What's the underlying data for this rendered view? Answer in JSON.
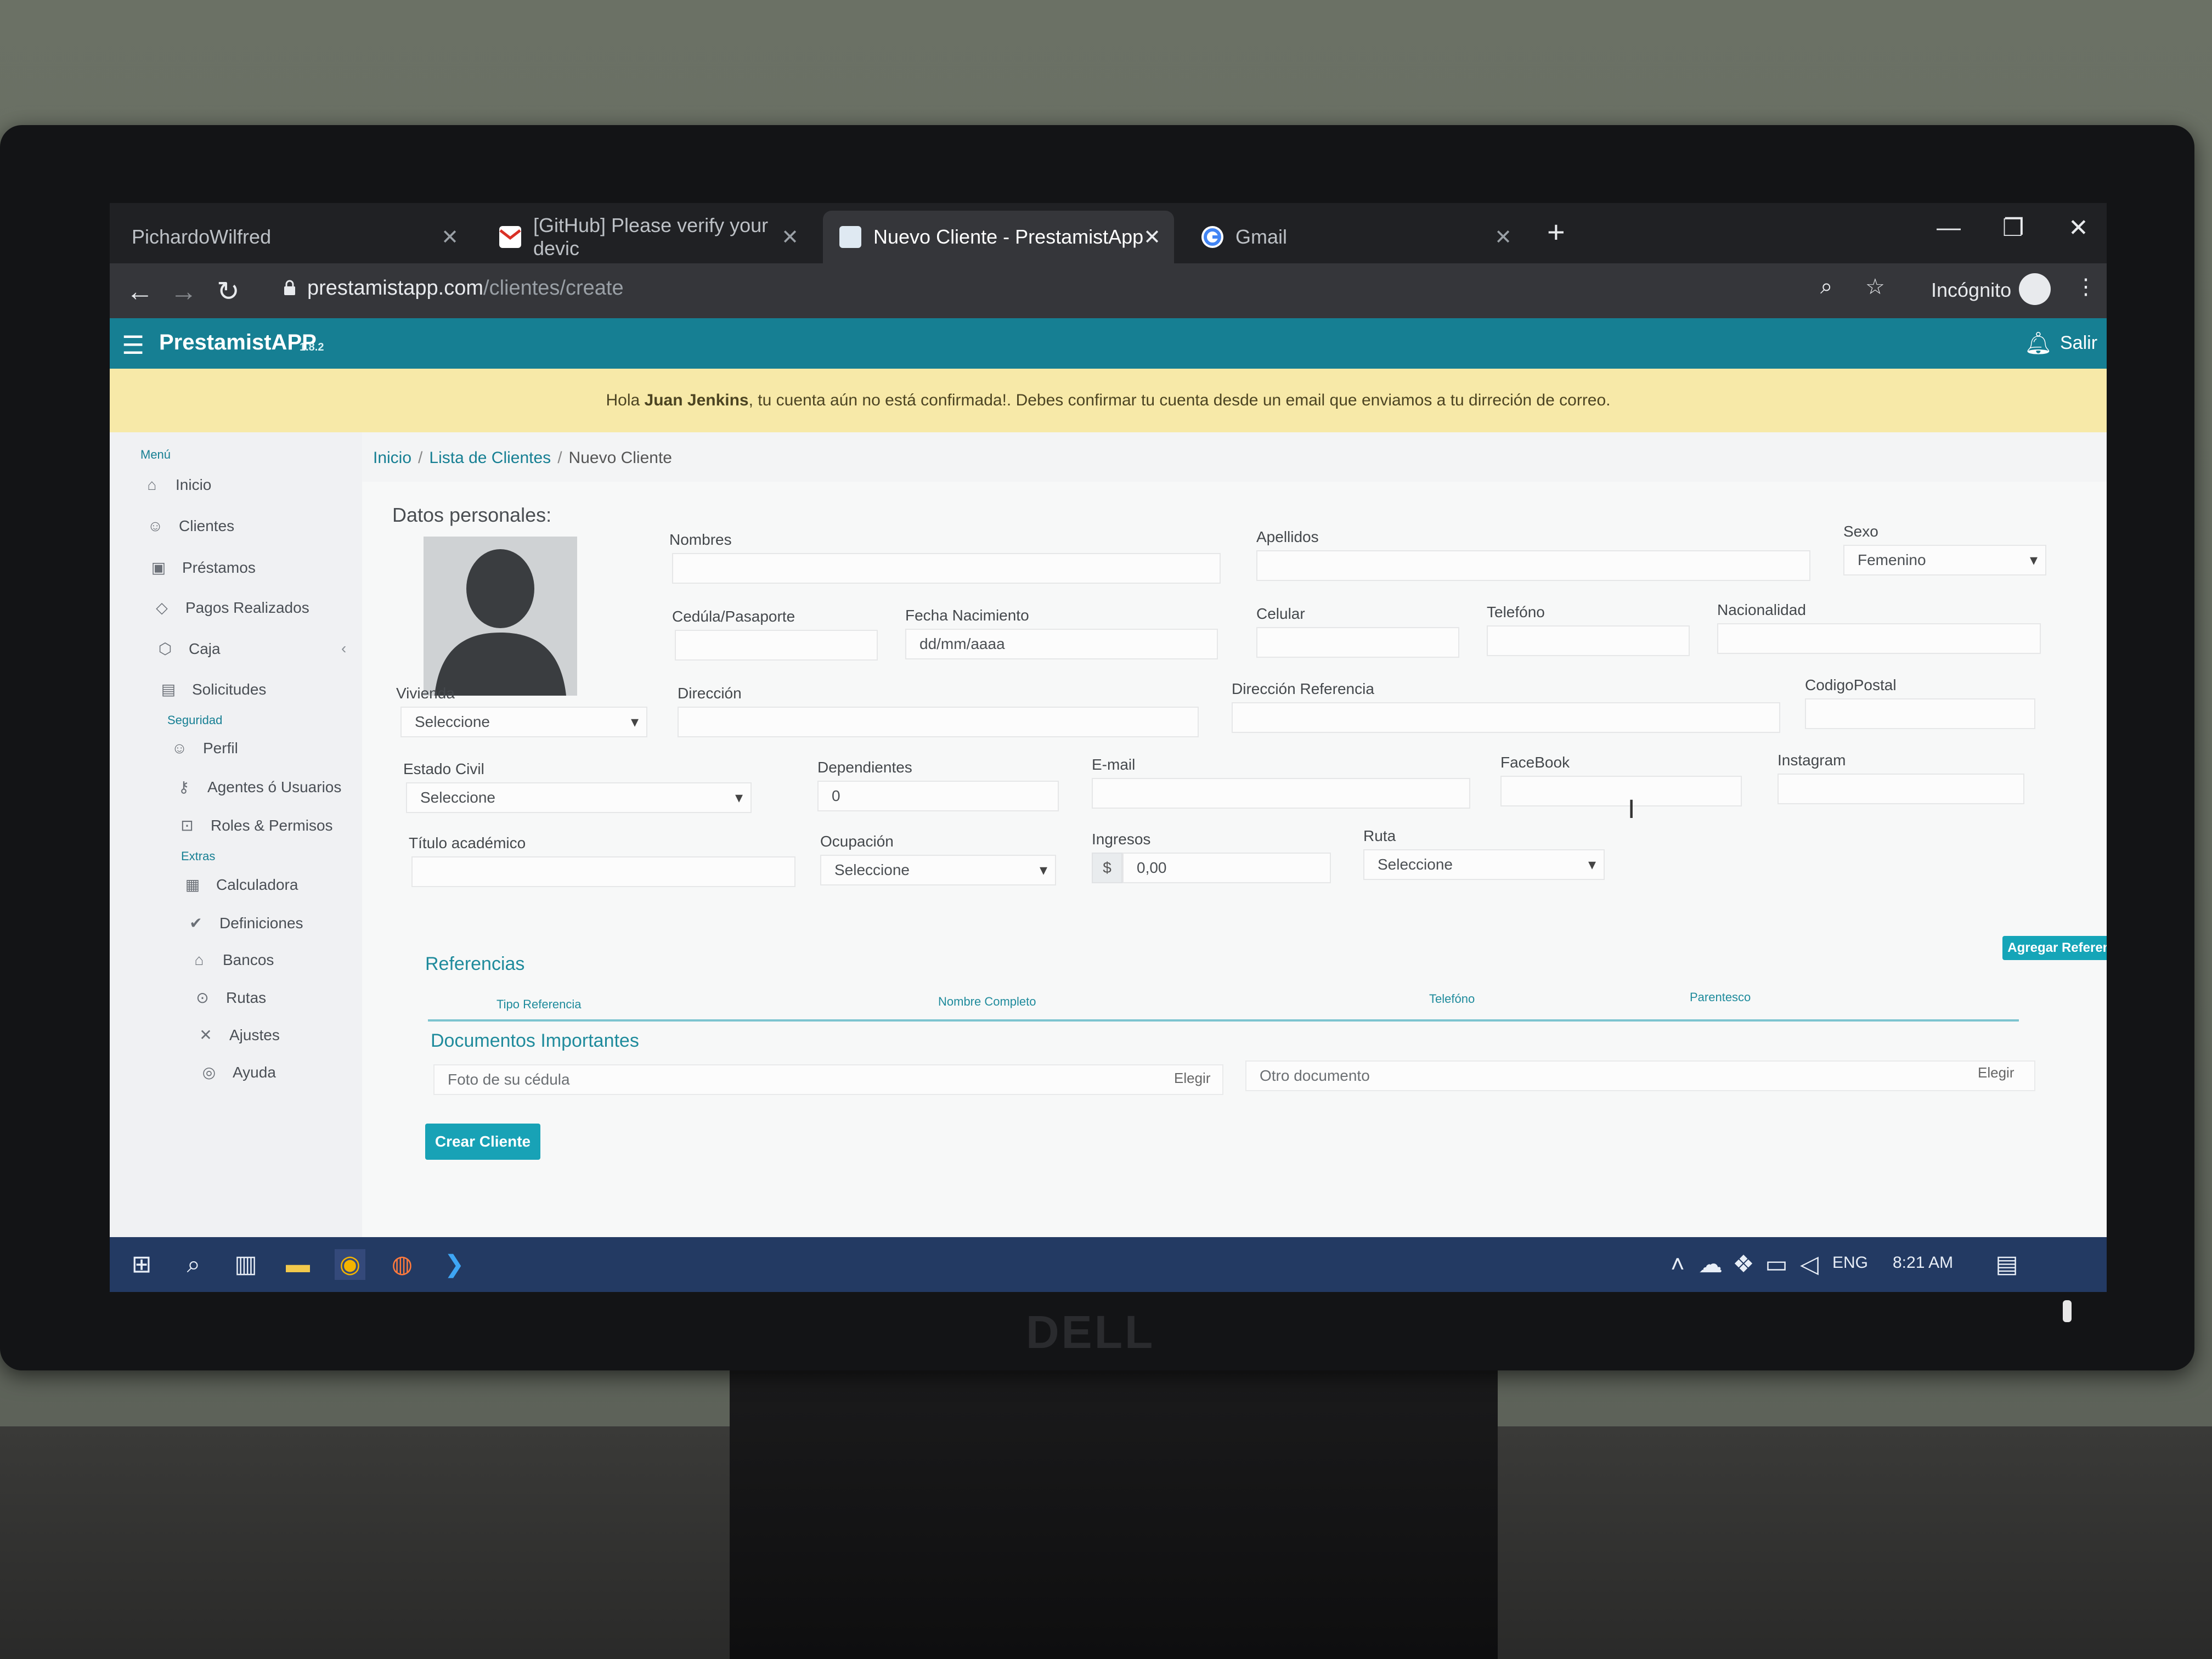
{
  "browser": {
    "tabs": [
      {
        "label": "PichardoWilfred",
        "icon": "blank-page-icon"
      },
      {
        "label": "[GitHub] Please verify your devic",
        "icon": "gmail-icon"
      },
      {
        "label": "Nuevo Cliente - PrestamistApp",
        "icon": "prestamistapp-icon"
      },
      {
        "label": "Gmail",
        "icon": "google-icon"
      }
    ],
    "active_tab": 2,
    "url_host": "prestamistapp.com",
    "url_path": "/clientes/create",
    "incognito_label": "Incógnito"
  },
  "app": {
    "title": "PrestamistAPP",
    "version": "1.8.2",
    "logout_label": "Salir",
    "alert_prefix": "Hola ",
    "alert_name": "Juan Jenkins",
    "alert_rest": ", tu cuenta aún no está confirmada!. Debes confirmar tu cuenta desde un email que enviamos a tu dirreción de correo."
  },
  "sidebar": {
    "menu_heading": "Menú",
    "security_heading": "Seguridad",
    "extras_heading": "Extras",
    "items": [
      {
        "label": "Inicio",
        "icon": "home-icon"
      },
      {
        "label": "Clientes",
        "icon": "user-icon"
      },
      {
        "label": "Préstamos",
        "icon": "wallet-icon"
      },
      {
        "label": "Pagos Realizados",
        "icon": "tag-icon"
      },
      {
        "label": "Caja",
        "icon": "box-icon"
      },
      {
        "label": "Solicitudes",
        "icon": "inbox-icon"
      },
      {
        "label": "Perfil",
        "icon": "user-icon"
      },
      {
        "label": "Agentes ó Usuarios",
        "icon": "key-icon"
      },
      {
        "label": "Roles & Permisos",
        "icon": "lock-icon"
      },
      {
        "label": "Calculadora",
        "icon": "calculator-icon"
      },
      {
        "label": "Definiciones",
        "icon": "check-icon"
      },
      {
        "label": "Bancos",
        "icon": "bank-icon"
      },
      {
        "label": "Rutas",
        "icon": "map-pin-icon"
      },
      {
        "label": "Ajustes",
        "icon": "tools-icon"
      },
      {
        "label": "Ayuda",
        "icon": "lifebuoy-icon"
      }
    ]
  },
  "breadcrumb": {
    "home": "Inicio",
    "list": "Lista de Clientes",
    "current": "Nuevo Cliente"
  },
  "form": {
    "section_personal": "Datos personales:",
    "nombres": {
      "label": "Nombres",
      "value": ""
    },
    "apellidos": {
      "label": "Apellidos",
      "value": ""
    },
    "sexo": {
      "label": "Sexo",
      "value": "Femenino"
    },
    "cedula": {
      "label": "Cedúla/Pasaporte",
      "value": ""
    },
    "fecha": {
      "label": "Fecha Nacimiento",
      "value": "dd/mm/aaaa"
    },
    "celular": {
      "label": "Celular",
      "value": ""
    },
    "telefono": {
      "label": "Telefóno",
      "value": ""
    },
    "nacionalidad": {
      "label": "Nacionalidad",
      "value": ""
    },
    "vivienda": {
      "label": "Vivienda",
      "value": "Seleccione"
    },
    "direccion": {
      "label": "Dirección",
      "value": ""
    },
    "direccion_ref": {
      "label": "Dirección Referencia",
      "value": ""
    },
    "codigo_postal": {
      "label": "CodigoPostal",
      "value": ""
    },
    "estado_civil": {
      "label": "Estado Civil",
      "value": "Seleccione"
    },
    "dependientes": {
      "label": "Dependientes",
      "value": "0"
    },
    "email": {
      "label": "E-mail",
      "value": ""
    },
    "facebook": {
      "label": "FaceBook",
      "value": ""
    },
    "instagram": {
      "label": "Instagram",
      "value": ""
    },
    "titulo": {
      "label": "Título académico",
      "value": ""
    },
    "ocupacion": {
      "label": "Ocupación",
      "value": "Seleccione"
    },
    "ingresos": {
      "label": "Ingresos",
      "currency": "$",
      "value": "0,00"
    },
    "ruta": {
      "label": "Ruta",
      "value": "Seleccione"
    },
    "referencias_title": "Referencias",
    "add_reference_label": "Agregar Referencia",
    "ref_columns": [
      "Tipo Referencia",
      "Nombre Completo",
      "Telefóno",
      "Parentesco"
    ],
    "documentos_title": "Documentos Importantes",
    "doc1_placeholder": "Foto de su cédula",
    "doc2_placeholder": "Otro documento",
    "choose_label": "Elegir",
    "submit_label": "Crear Cliente"
  },
  "taskbar": {
    "lang": "ENG",
    "time": "8:21 AM"
  },
  "monitor_brand": "DELL"
}
